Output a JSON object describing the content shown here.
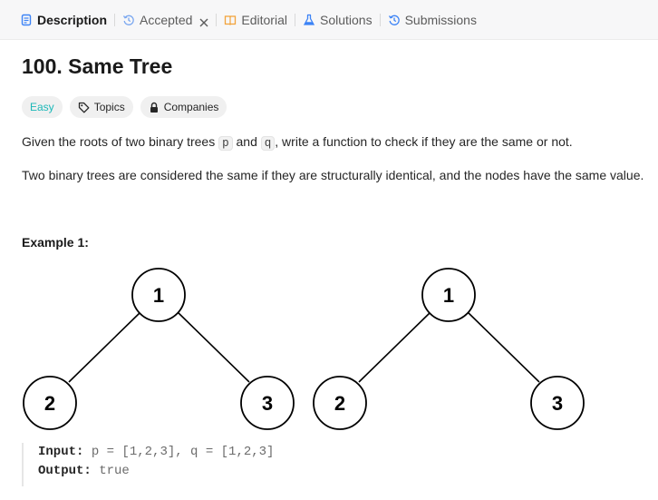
{
  "tabs": [
    {
      "label": "Description",
      "icon": "description-icon",
      "active": true
    },
    {
      "label": "Accepted",
      "icon": "history-icon",
      "closable": true
    },
    {
      "label": "Editorial",
      "icon": "book-icon"
    },
    {
      "label": "Solutions",
      "icon": "flask-icon"
    },
    {
      "label": "Submissions",
      "icon": "history-icon"
    }
  ],
  "problem": {
    "title": "100. Same Tree",
    "difficulty": "Easy",
    "topics_label": "Topics",
    "companies_label": "Companies",
    "p1_before": "Given the roots of two binary trees ",
    "p1_p": "p",
    "p1_and": " and ",
    "p1_q": "q",
    "p1_after": ", write a function to check if they are the same or not.",
    "p2": "Two binary trees are considered the same if they are structurally identical, and the nodes have the same value."
  },
  "example": {
    "heading": "Example 1:",
    "tree_p": {
      "root": "1",
      "left": "2",
      "right": "3"
    },
    "tree_q": {
      "root": "1",
      "left": "2",
      "right": "3"
    },
    "input_label": "Input:",
    "input_value": "p = [1,2,3], q = [1,2,3]",
    "output_label": "Output:",
    "output_value": "true"
  },
  "colors": {
    "easy": "#1cb8b8",
    "tab_active": "#1a1a1a"
  }
}
